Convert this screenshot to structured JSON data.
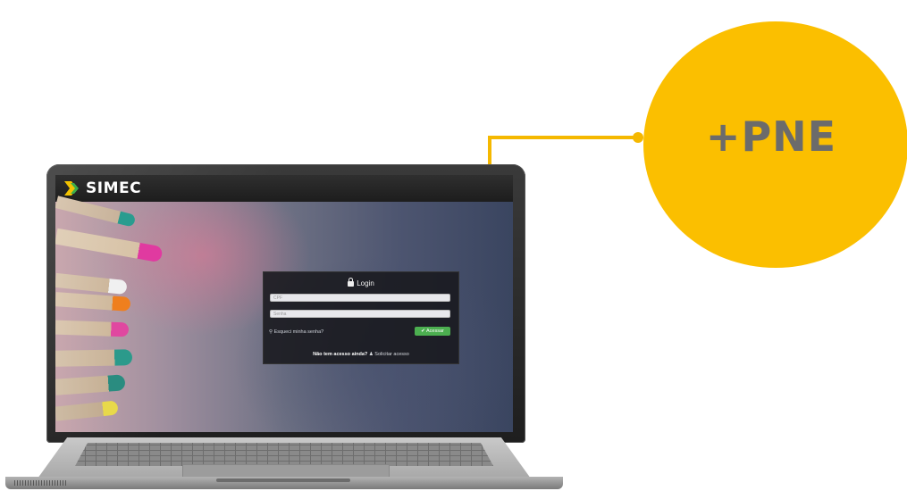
{
  "callout": {
    "label": "+PNE",
    "accent_color": "#fbbf00"
  },
  "app": {
    "logo_text": "SIMEC",
    "logo_icon": "chevron-arrow-icon"
  },
  "login": {
    "title": "Login",
    "title_icon": "lock-icon",
    "cpf_placeholder": "CPF",
    "password_placeholder": "Senha",
    "forgot_link": "Esqueci minha senha?",
    "forgot_icon": "key-icon",
    "submit_label": "Acessar",
    "submit_icon": "check-icon",
    "no_access_text": "Não tem acesso ainda?",
    "request_access_link": "Solicitar acesso",
    "request_icon": "user-icon",
    "submit_color": "#4caf50"
  }
}
